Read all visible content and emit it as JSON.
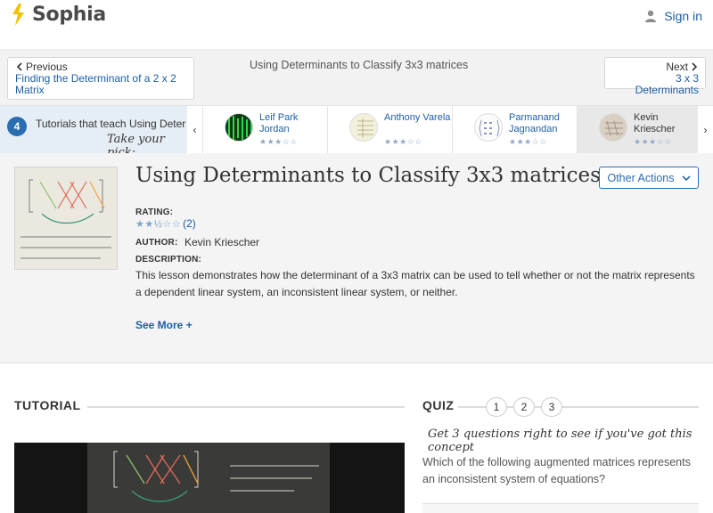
{
  "header": {
    "brand": "Sophia",
    "signin_label": "Sign in"
  },
  "nav": {
    "previous_label": "Previous",
    "previous_link": "Finding the Determinant of a 2 x 2 Matrix",
    "current_title": "Using Determinants to Classify 3x3 matrices",
    "next_label": "Next",
    "next_link": "3 x 3 Determinants"
  },
  "strip": {
    "count": "4",
    "text": "Tutorials that teach Using Deter",
    "pick": "Take your pick:",
    "prev_arrow": "‹",
    "next_arrow": "›",
    "tutors": [
      {
        "name": "Leif Park Jordan",
        "stars": "★★★☆☆"
      },
      {
        "name": "Anthony Varela",
        "stars": "★★★☆☆"
      },
      {
        "name": "Parmanand Jagnandan",
        "stars": "★★★☆☆"
      },
      {
        "name": "Kevin Kriescher",
        "stars": "★★★☆☆"
      }
    ]
  },
  "lesson": {
    "title": "Using Determinants to Classify 3x3 matrices",
    "other_actions": "Other Actions",
    "rating_label": "RATING:",
    "rating_stars": "★★½☆☆",
    "rating_count": "(2)",
    "author_label": "AUTHOR:",
    "author": "Kevin Kriescher",
    "description_label": "DESCRIPTION:",
    "description": "This lesson demonstrates how the determinant of a 3x3 matrix can be used to tell whether or not the matrix represents a dependent linear system, an inconsistent linear system, or neither.",
    "see_more": "See More +"
  },
  "tutorial": {
    "heading": "TUTORIAL"
  },
  "quiz": {
    "heading": "QUIZ",
    "numbers": [
      "1",
      "2",
      "3"
    ],
    "prompt": "Get 3 questions right to see if you've got this concept",
    "question": "Which of the following augmented matrices represents an inconsistent system of equations?"
  }
}
